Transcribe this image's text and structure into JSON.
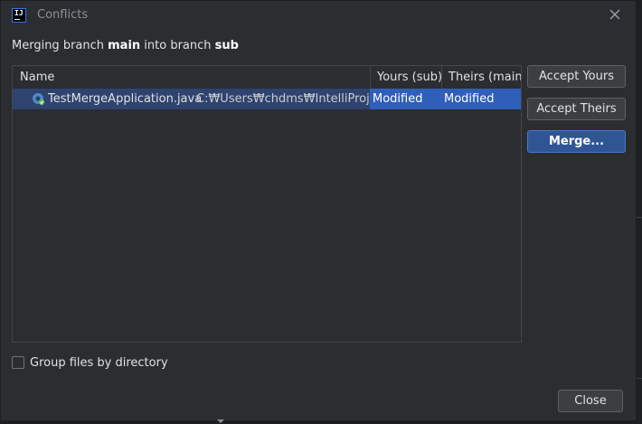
{
  "window": {
    "title": "Conflicts",
    "app_icon_text": "IJ",
    "close_icon": "close-icon"
  },
  "subtitle": {
    "prefix": "Merging branch ",
    "source_branch": "main",
    "middle": " into branch ",
    "target_branch": "sub"
  },
  "table": {
    "columns": {
      "name": "Name",
      "yours": "Yours (sub)",
      "theirs": "Theirs (main)"
    },
    "rows": [
      {
        "file_name": "TestMergeApplication.java",
        "path": "C:₩Users₩chdms₩IntelliProject₩",
        "yours": "Modified",
        "theirs": "Modified",
        "icon": "java-class-icon",
        "selected": true
      }
    ]
  },
  "actions": {
    "accept_yours": "Accept Yours",
    "accept_theirs": "Accept Theirs",
    "merge": "Merge..."
  },
  "options": {
    "group_by_directory_label": "Group files by directory",
    "group_by_directory_checked": false
  },
  "footer": {
    "close": "Close"
  },
  "colors": {
    "background": "#2b2d30",
    "selection": "#2f5fb8",
    "accent": "#3574f0"
  }
}
